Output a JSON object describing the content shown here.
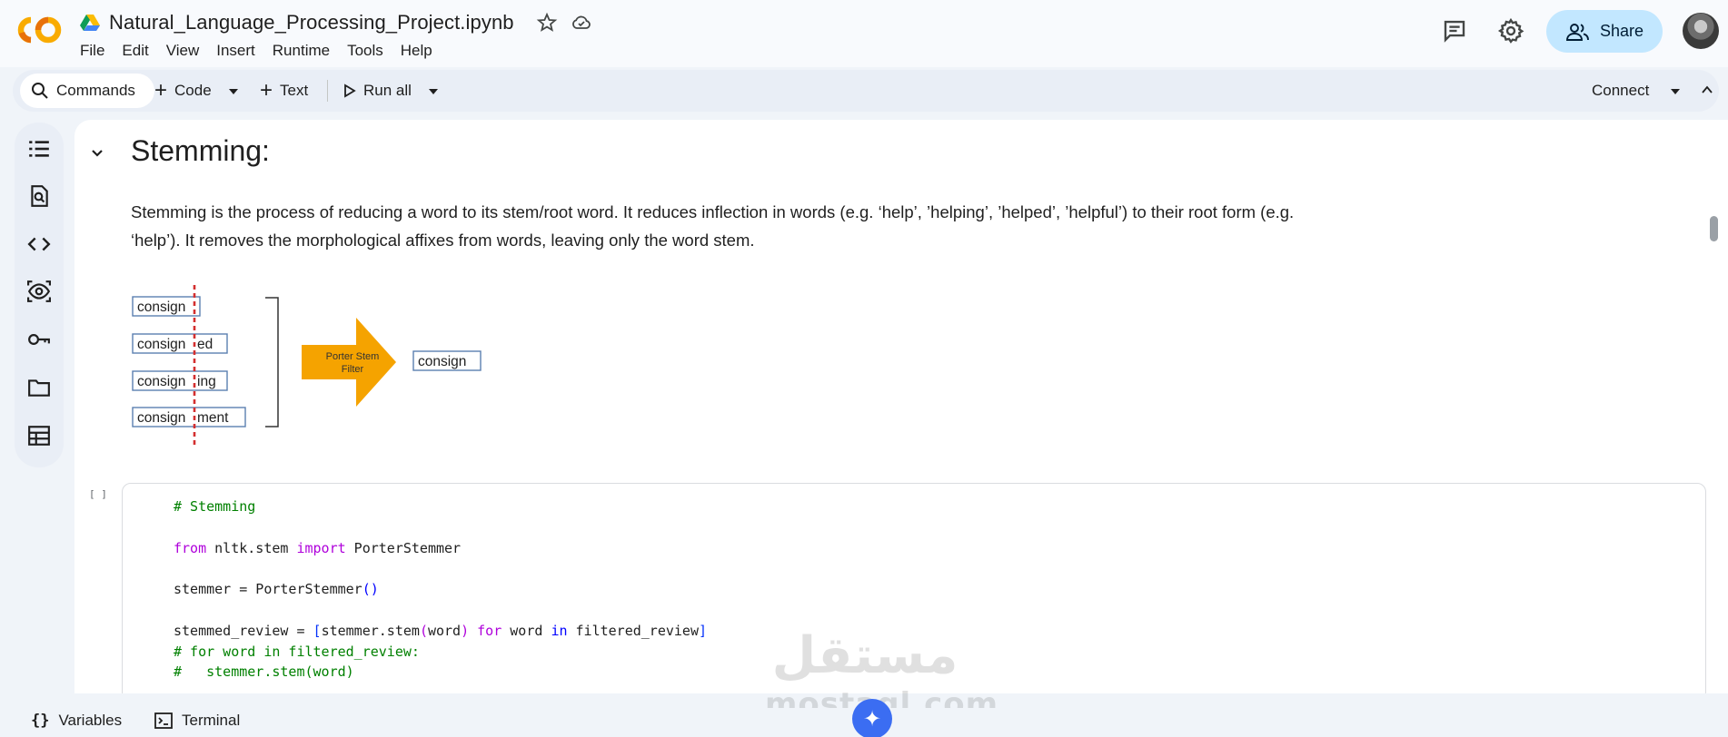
{
  "header": {
    "doc_title": "Natural_Language_Processing_Project.ipynb",
    "menu": [
      "File",
      "Edit",
      "View",
      "Insert",
      "Runtime",
      "Tools",
      "Help"
    ],
    "share_label": "Share",
    "icons": [
      "colab-logo-icon",
      "drive-icon",
      "star-icon",
      "cloud-icon",
      "comment-icon",
      "gear-icon",
      "share-people-icon",
      "avatar"
    ]
  },
  "toolbar": {
    "commands_label": "Commands",
    "code_label": "Code",
    "text_label": "Text",
    "run_all_label": "Run all",
    "connect_label": "Connect"
  },
  "rail": {
    "icons": [
      "table-of-contents-icon",
      "find-replace-icon",
      "code-snippets-icon",
      "variables-inspector-icon",
      "secrets-key-icon",
      "files-folder-icon",
      "data-table-icon"
    ]
  },
  "markdown": {
    "heading": "Stemming:",
    "paragraph": "Stemming is the process of reducing a word to its stem/root word. It reduces inflection in words (e.g. ‘help’, ’helping’, ’helped’, ’helpful’) to their root form (e.g. ‘help’). It removes the morphological affixes from words, leaving only the word stem."
  },
  "diagram": {
    "words": [
      {
        "stem": "consign",
        "suffix": ""
      },
      {
        "stem": "consign",
        "suffix": "ed"
      },
      {
        "stem": "consign",
        "suffix": "ing"
      },
      {
        "stem": "consign",
        "suffix": "ment"
      }
    ],
    "filter_line1": "Porter Stem",
    "filter_line2": "Filter",
    "result": "consign",
    "arrow_color": "#f5a300",
    "cut_line_color": "#d32f2f"
  },
  "code_cell": {
    "exec_indicator": "[ ]",
    "comment_title": "# Stemming",
    "kw_from": "from",
    "module": " nltk.stem ",
    "kw_import": "import",
    "import_name": " PorterStemmer",
    "assign_var": "stemmer = PorterStemmer",
    "parens": "()",
    "list_var": "stemmed_review = ",
    "br_open": "[",
    "call": "stemmer.stem",
    "arg_open": "(",
    "arg": "word",
    "arg_close": ")",
    "kw_for": " for",
    "word_var": " word ",
    "kw_in": "in",
    "iter_var": " filtered_review",
    "br_close": "]",
    "comment_loop": "# for word in filtered_review:",
    "comment_body": "#   stemmer.stem(word)"
  },
  "bottombar": {
    "variables_label": "Variables",
    "terminal_label": "Terminal"
  },
  "watermark": {
    "arabic": "مستقل",
    "latin": "mostaql.com"
  }
}
